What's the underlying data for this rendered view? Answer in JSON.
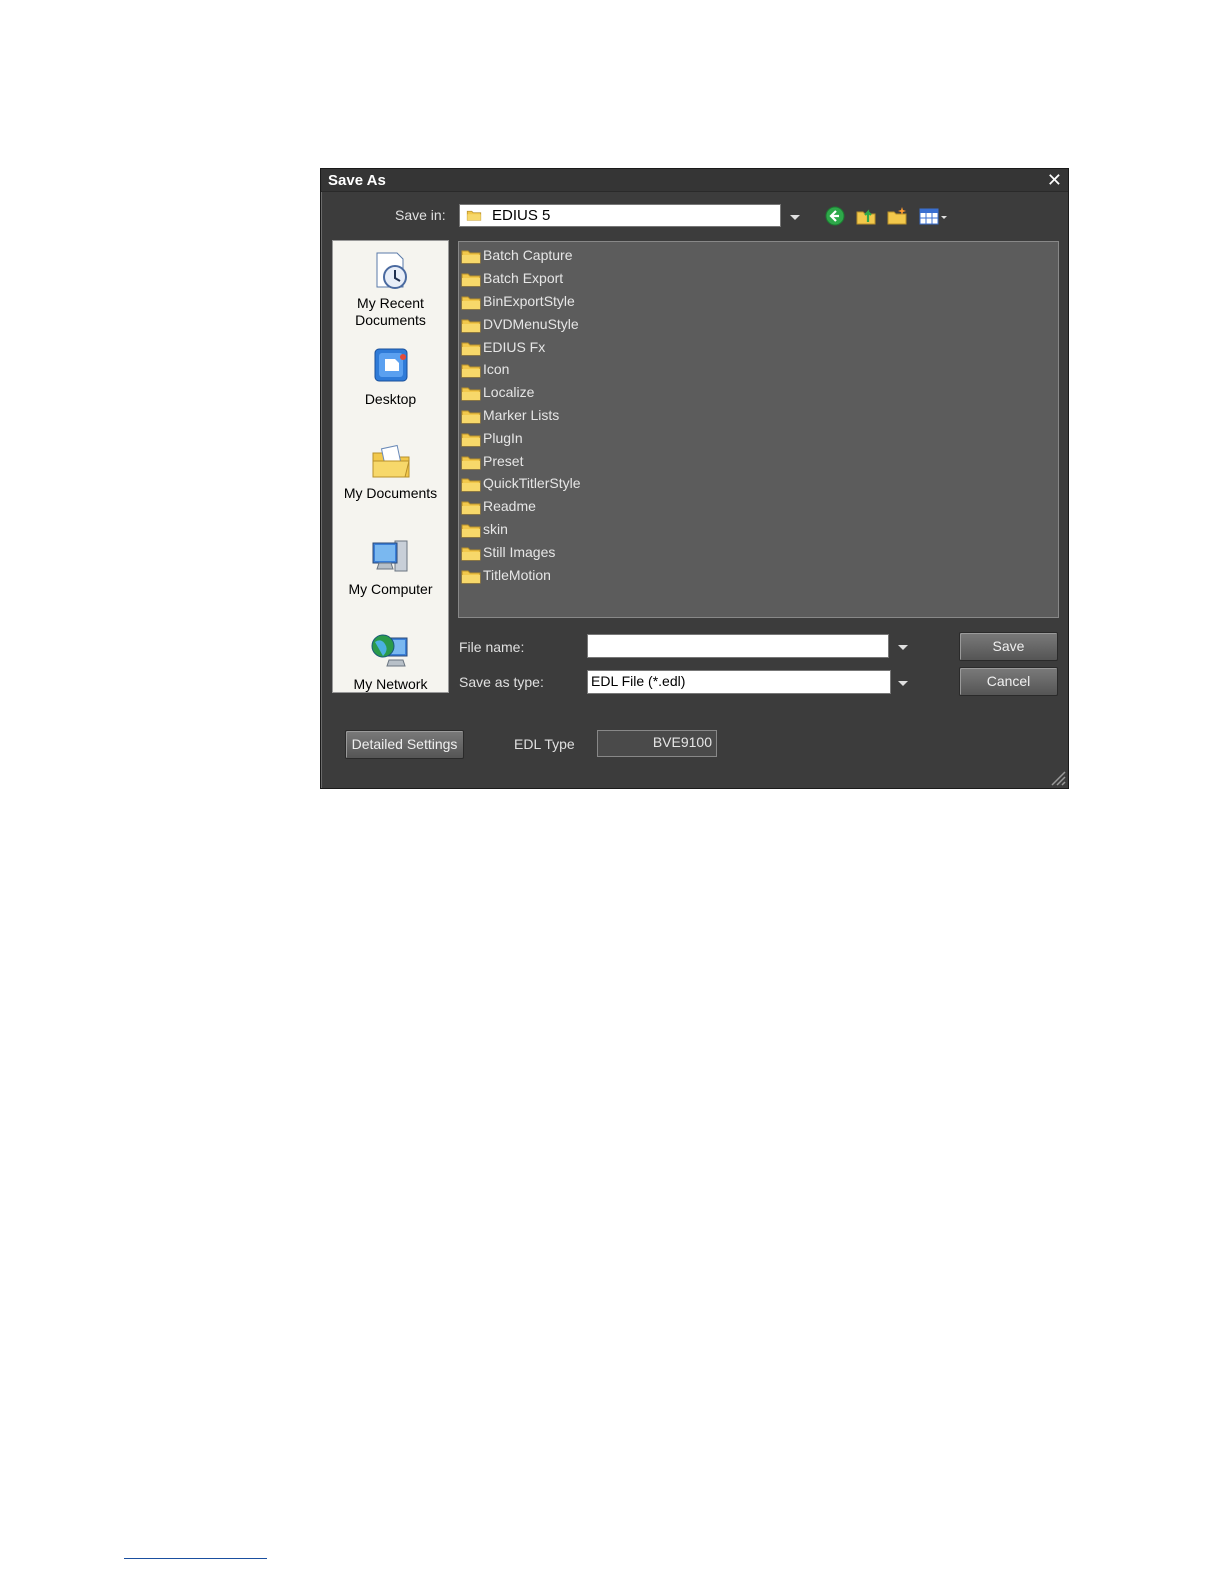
{
  "dialog": {
    "title": "Save As",
    "save_in_label": "Save in:",
    "save_in_value": "EDIUS 5",
    "toolbar_icons": [
      "back-icon",
      "up-folder-icon",
      "new-folder-icon",
      "views-menu-icon"
    ]
  },
  "places": [
    {
      "label": "My Recent Documents",
      "icon": "recent-documents-icon"
    },
    {
      "label": "Desktop",
      "icon": "desktop-icon"
    },
    {
      "label": "My Documents",
      "icon": "my-documents-icon"
    },
    {
      "label": "My Computer",
      "icon": "my-computer-icon"
    },
    {
      "label": "My Network",
      "icon": "my-network-icon"
    }
  ],
  "files": [
    "Batch Capture",
    "Batch Export",
    "BinExportStyle",
    "DVDMenuStyle",
    "EDIUS Fx",
    "Icon",
    "Localize",
    "Marker Lists",
    "PlugIn",
    "Preset",
    "QuickTitlerStyle",
    "Readme",
    "skin",
    "Still Images",
    "TitleMotion"
  ],
  "form": {
    "file_name_label": "File name:",
    "file_name_value": "",
    "save_as_type_label": "Save as type:",
    "save_as_type_value": "EDL File (*.edl)"
  },
  "buttons": {
    "save": "Save",
    "cancel": "Cancel",
    "detailed_settings": "Detailed Settings"
  },
  "edl": {
    "label": "EDL Type",
    "value": "BVE9100"
  },
  "colors": {
    "dialog_bg": "#3c3c3c",
    "file_list_bg": "#5c5c5c",
    "places_bg": "#f5f4ef",
    "folder_yellow": "#f2c84b"
  }
}
